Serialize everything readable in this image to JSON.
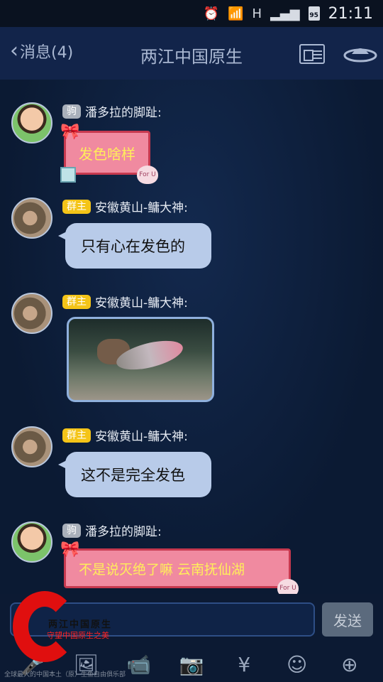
{
  "status_bar": {
    "time": "21:11",
    "battery": "95",
    "network": "H"
  },
  "nav": {
    "back_label": "消息(4)",
    "title": "两江中国原生"
  },
  "messages": [
    {
      "sender": "潘多拉的脚趾:",
      "tag": "驹",
      "text": "发色啥样",
      "kind": "gift"
    },
    {
      "sender": "安徽黄山-鳙大神:",
      "tag": "群主",
      "text": "只有心在发色的",
      "kind": "text"
    },
    {
      "sender": "安徽黄山-鳙大神:",
      "tag": "群主",
      "kind": "image"
    },
    {
      "sender": "安徽黄山-鳙大神:",
      "tag": "群主",
      "text": "这不是完全发色",
      "kind": "text"
    },
    {
      "sender": "潘多拉的脚趾:",
      "tag": "驹",
      "text": "不是说灭绝了嘛 云南抚仙湖",
      "kind": "gift"
    }
  ],
  "gift_sticker": "For U",
  "input": {
    "send_label": "发送",
    "placeholder": ""
  },
  "toolbar_icons": [
    "mic-icon",
    "image-icon",
    "video-icon",
    "camera-icon",
    "red-packet-icon",
    "emoji-icon",
    "plus-icon"
  ],
  "watermark": {
    "line1": "两江中国原生",
    "line2": "守望中国原生之美",
    "line3": "全球最大的中国本土（原）生鱼自由俱乐部"
  },
  "colors": {
    "chat_bg": "#0c1a33",
    "bubble": "#b8cbe9",
    "tag_admin": "#f4c418",
    "tag_member": "#a9b0bb",
    "gift": "#f08aa0"
  }
}
